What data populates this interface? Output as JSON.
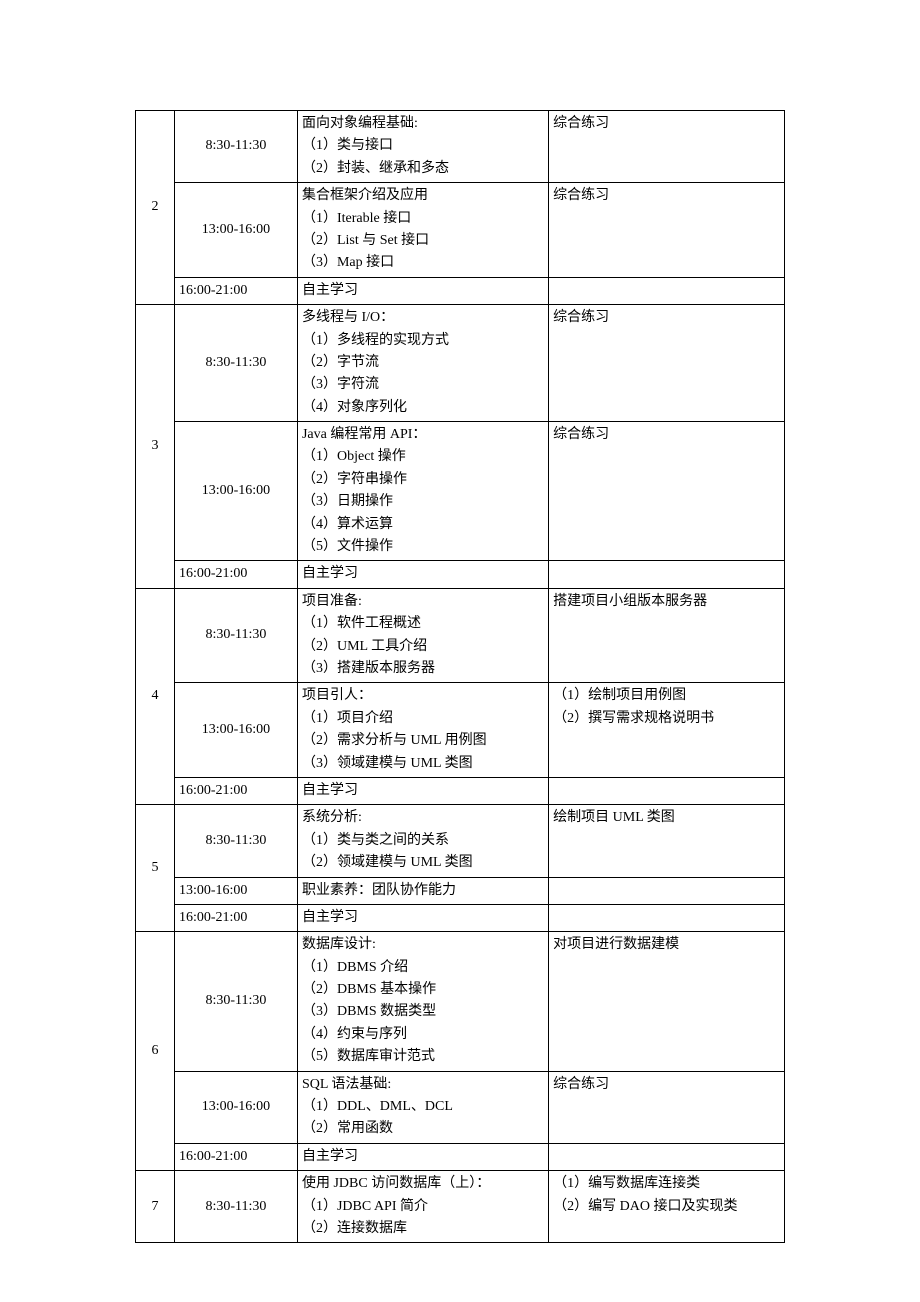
{
  "days": [
    {
      "num": "2",
      "slots": [
        {
          "time": "8:30-11:30",
          "content": [
            "面向对象编程基础:",
            "（1）类与接口",
            "（2）封装、继承和多态"
          ],
          "note": [
            "综合练习"
          ]
        },
        {
          "time": "13:00-16:00",
          "content": [
            "集合框架介绍及应用",
            "（1）Iterable 接口",
            "（2）List 与 Set 接口",
            "（3）Map 接口"
          ],
          "note": [
            "综合练习"
          ]
        },
        {
          "time": "16:00-21:00",
          "content": [
            "自主学习"
          ],
          "note": []
        }
      ]
    },
    {
      "num": "3",
      "slots": [
        {
          "time": "8:30-11:30",
          "content": [
            "多线程与 I/O：",
            "（1）多线程的实现方式",
            "（2）字节流",
            "（3）字符流",
            "（4）对象序列化"
          ],
          "note": [
            "综合练习"
          ]
        },
        {
          "time": "13:00-16:00",
          "content": [
            "Java 编程常用 API：",
            "（1）Object 操作",
            "（2）字符串操作",
            "（3）日期操作",
            "（4）算术运算",
            "（5）文件操作"
          ],
          "note": [
            "综合练习"
          ]
        },
        {
          "time": "16:00-21:00",
          "content": [
            "自主学习"
          ],
          "note": []
        }
      ]
    },
    {
      "num": "4",
      "slots": [
        {
          "time": "8:30-11:30",
          "content": [
            "项目准备:",
            "（1）软件工程概述",
            "（2）UML 工具介绍",
            "（3）搭建版本服务器"
          ],
          "note": [
            "搭建项目小组版本服务器"
          ]
        },
        {
          "time": "13:00-16:00",
          "content": [
            "项目引人：",
            "（1）项目介绍",
            "（2）需求分析与 UML 用例图",
            "（3）领域建模与 UML 类图"
          ],
          "note": [
            "（1）绘制项目用例图",
            "（2）撰写需求规格说明书"
          ]
        },
        {
          "time": "16:00-21:00",
          "content": [
            "自主学习"
          ],
          "note": []
        }
      ]
    },
    {
      "num": "5",
      "slots": [
        {
          "time": "8:30-11:30",
          "content": [
            "系统分析:",
            "（1）类与类之间的关系",
            "（2）领域建模与 UML 类图"
          ],
          "note": [
            "绘制项目 UML 类图"
          ]
        },
        {
          "time": "13:00-16:00",
          "content": [
            "职业素养：团队协作能力"
          ],
          "note": []
        },
        {
          "time": "16:00-21:00",
          "content": [
            "自主学习"
          ],
          "note": []
        }
      ]
    },
    {
      "num": "6",
      "slots": [
        {
          "time": "8:30-11:30",
          "content": [
            "数据库设计:",
            "（1）DBMS 介绍",
            "（2）DBMS 基本操作",
            "（3）DBMS 数据类型",
            "（4）约束与序列",
            "（5）数据库审计范式"
          ],
          "note": [
            "对项目进行数据建模"
          ]
        },
        {
          "time": "13:00-16:00",
          "content": [
            "SQL 语法基础:",
            "（1）DDL、DML、DCL",
            "（2）常用函数"
          ],
          "note": [
            "综合练习"
          ]
        },
        {
          "time": "16:00-21:00",
          "content": [
            "自主学习"
          ],
          "note": []
        }
      ]
    },
    {
      "num": "7",
      "slots": [
        {
          "time": "8:30-11:30",
          "content": [
            "使用 JDBC 访问数据库（上）：",
            "（1）JDBC API 简介",
            "（2）连接数据库"
          ],
          "note": [
            "（1）编写数据库连接类",
            "（2）编写 DAO 接口及实现类"
          ]
        }
      ]
    }
  ]
}
